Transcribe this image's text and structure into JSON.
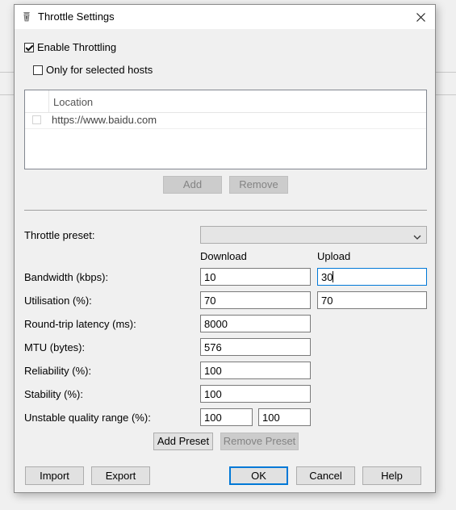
{
  "dialog": {
    "title": "Throttle Settings",
    "enable_throttling": {
      "label": "Enable Throttling",
      "checked": true
    },
    "only_selected_hosts": {
      "label": "Only for selected hosts",
      "checked": false
    },
    "hosts": {
      "column_header": "Location",
      "rows": [
        {
          "location": "https://www.baidu.com",
          "checked": false
        }
      ],
      "add_label": "Add",
      "remove_label": "Remove"
    },
    "preset": {
      "label": "Throttle preset:",
      "selected": ""
    },
    "columns": {
      "download": "Download",
      "upload": "Upload"
    },
    "bandwidth": {
      "label": "Bandwidth (kbps):",
      "download": "10",
      "upload": "30"
    },
    "utilisation": {
      "label": "Utilisation (%):",
      "download": "70",
      "upload": "70"
    },
    "latency": {
      "label": "Round-trip latency (ms):",
      "value": "8000"
    },
    "mtu": {
      "label": "MTU (bytes):",
      "value": "576"
    },
    "reliability": {
      "label": "Reliability (%):",
      "value": "100"
    },
    "stability": {
      "label": "Stability (%):",
      "value": "100"
    },
    "unstable_range": {
      "label": "Unstable quality range (%):",
      "min": "100",
      "max": "100"
    },
    "add_preset_label": "Add Preset",
    "remove_preset_label": "Remove Preset",
    "import_label": "Import",
    "export_label": "Export",
    "ok_label": "OK",
    "cancel_label": "Cancel",
    "help_label": "Help"
  },
  "icons": {
    "title": "throttle-app-icon",
    "close": "close-icon",
    "dropdown": "chevron-down-icon"
  },
  "colors": {
    "focus_accent": "#0078d7",
    "disabled_button": "#cccccc",
    "title_bar": "#ffffff"
  }
}
